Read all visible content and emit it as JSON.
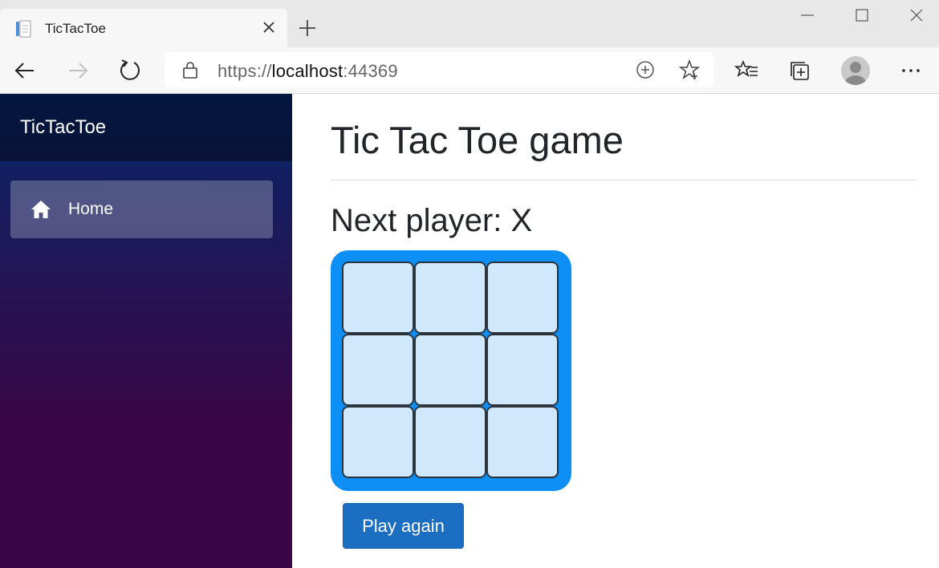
{
  "browser": {
    "tab_title": "TicTacToe",
    "url_scheme": "https://",
    "url_host": "localhost",
    "url_port": ":44369"
  },
  "sidebar": {
    "brand": "TicTacToe",
    "nav": [
      {
        "label": "Home",
        "icon": "home-icon",
        "active": true
      }
    ]
  },
  "main": {
    "title": "Tic Tac Toe game",
    "status": "Next player: X",
    "board": [
      "",
      "",
      "",
      "",
      "",
      "",
      "",
      "",
      ""
    ],
    "play_again_label": "Play again"
  },
  "colors": {
    "board_bg": "#0d8ff5",
    "cell_bg": "#d0e8fb",
    "button_bg": "#1b6ec2",
    "sidebar_top": "#052767",
    "sidebar_bottom": "#3a0647"
  }
}
